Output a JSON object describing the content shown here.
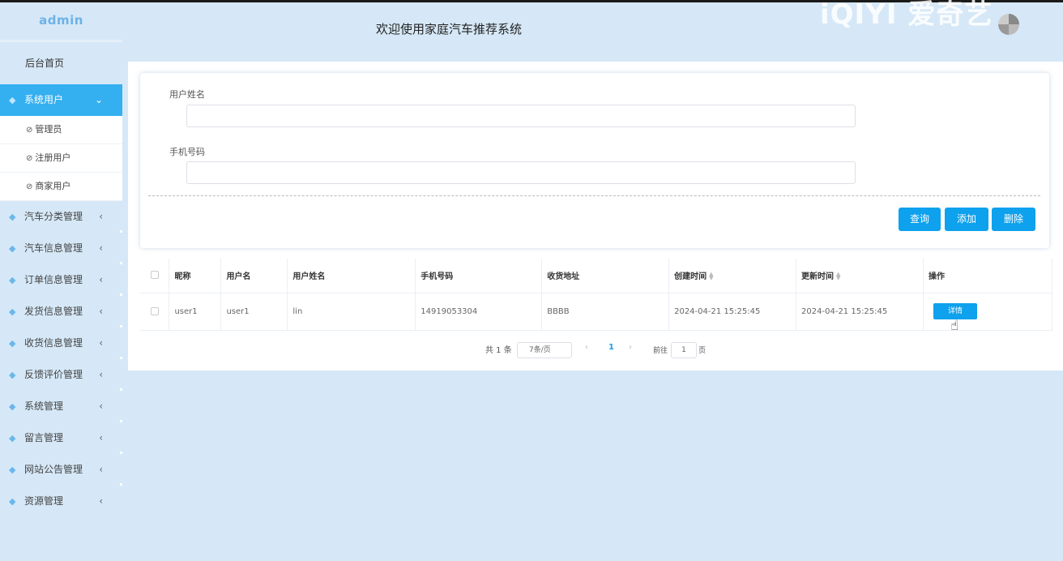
{
  "sidebar": {
    "brand": "admin",
    "home": "后台首页",
    "active_menu": "系统用户",
    "sub_items": [
      "管理员",
      "注册用户",
      "商家用户"
    ],
    "menus": [
      "汽车分类管理",
      "汽车信息管理",
      "订单信息管理",
      "发货信息管理",
      "收货信息管理",
      "反馈评价管理",
      "系统管理",
      "留言管理",
      "网站公告管理",
      "资源管理"
    ]
  },
  "header": {
    "title": "欢迎使用家庭汽车推荐系统",
    "watermark": "iQIYI 爱奇艺"
  },
  "search": {
    "name_label": "用户姓名",
    "phone_label": "手机号码",
    "name_value": "",
    "phone_value": "",
    "query_button": "查询",
    "add_button": "添加",
    "delete_button": "删除"
  },
  "table": {
    "columns": [
      "昵称",
      "用户名",
      "用户姓名",
      "手机号码",
      "收货地址",
      "创建时间",
      "更新时间",
      "操作"
    ],
    "rows": [
      {
        "nickname": "user1",
        "username": "user1",
        "realname": "lin",
        "phone": "14919053304",
        "address": "BBBB",
        "created": "2024-04-21 15:25:45",
        "updated": "2024-04-21 15:25:45",
        "action": "详情"
      }
    ]
  },
  "pagination": {
    "total": "共 1 条",
    "page_size": "7条/页",
    "current_page": "1",
    "goto_label": "前往",
    "goto_value": "1",
    "page_suffix": "页"
  },
  "colors": {
    "accent": "#0ea1ed",
    "sidebar_active": "#34aff0",
    "background": "#d6e8f7"
  }
}
